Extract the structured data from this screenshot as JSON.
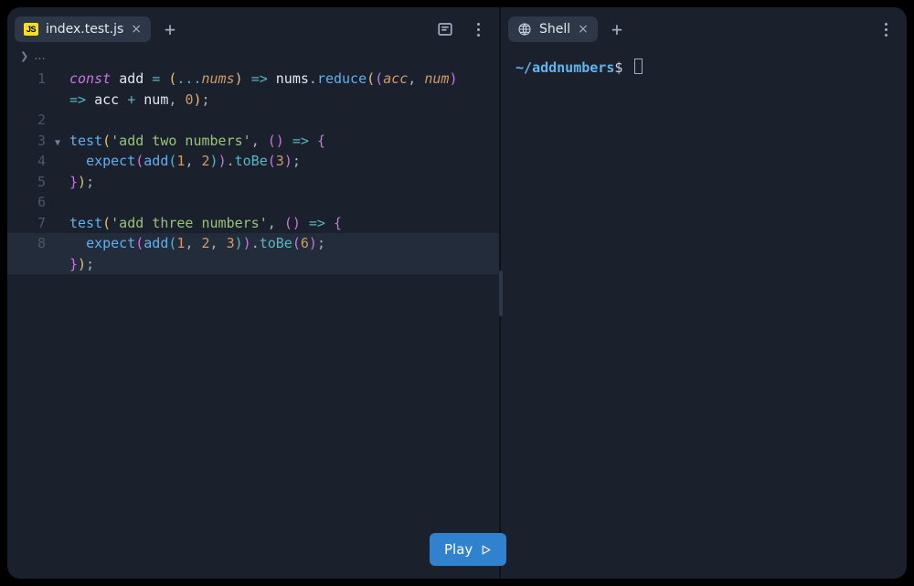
{
  "editor_pane": {
    "tab": {
      "icon_label": "JS",
      "filename": "index.test.js"
    },
    "breadcrumb": "...",
    "code": {
      "lines": [
        {
          "n": "1",
          "html": "<span class='k-decl'>const</span> <span class='k-var'>add</span> <span class='k-op'>=</span> <span class='k-paren'>(</span><span class='k-spread'>...</span><span class='k-param'>nums</span><span class='k-paren'>)</span> <span class='k-op'>=&gt;</span> <span class='k-var'>nums</span><span class='k-dot'>.</span><span class='k-fn'>reduce</span><span class='k-paren'>(</span><span class='k-paren2'>(</span><span class='k-param'>acc</span><span class='k-punc'>,</span> <span class='k-param'>num</span><span class='k-paren2'>)</span>"
        },
        {
          "n": "",
          "wrap": true,
          "html": "<span class='k-op'>=&gt;</span> <span class='k-var'>acc</span> <span class='k-op'>+</span> <span class='k-var'>num</span><span class='k-punc'>,</span> <span class='k-num'>0</span><span class='k-paren'>)</span><span class='k-punc'>;</span>"
        },
        {
          "n": "2",
          "html": ""
        },
        {
          "n": "3",
          "fold": true,
          "html": "<span class='k-fn'>test</span><span class='k-paren'>(</span><span class='k-str'>'add two numbers'</span><span class='k-punc'>,</span> <span class='k-paren2'>(</span><span class='k-paren2'>)</span> <span class='k-op'>=&gt;</span> <span class='k-paren2'>{</span>"
        },
        {
          "n": "4",
          "html": "  <span class='k-fn'>expect</span><span class='k-paren2'>(</span><span class='k-fn'>add</span><span class='k-paren3'>(</span><span class='k-num'>1</span><span class='k-punc'>,</span> <span class='k-num'>2</span><span class='k-paren3'>)</span><span class='k-paren2'>)</span><span class='k-dot'>.</span><span class='k-method'>toBe</span><span class='k-paren2'>(</span><span class='k-num'>3</span><span class='k-paren2'>)</span><span class='k-punc'>;</span>"
        },
        {
          "n": "5",
          "html": "<span class='k-paren2'>}</span><span class='k-paren'>)</span><span class='k-punc'>;</span>"
        },
        {
          "n": "6",
          "html": ""
        },
        {
          "n": "7",
          "html": "<span class='k-fn'>test</span><span class='k-paren'>(</span><span class='k-str'>'add three numbers'</span><span class='k-punc'>,</span> <span class='k-paren2'>(</span><span class='k-paren2'>)</span> <span class='k-op'>=&gt;</span> <span class='k-paren2'>{</span>"
        },
        {
          "n": "8",
          "hl": true,
          "html": "  <span class='k-fn'>expect</span><span class='k-paren2'>(</span><span class='k-fn'>add</span><span class='k-paren3'>(</span><span class='k-num'>1</span><span class='k-punc'>,</span> <span class='k-num'>2</span><span class='k-punc'>,</span> <span class='k-num'>3</span><span class='k-paren3'>)</span><span class='k-paren2'>)</span><span class='k-dot'>.</span><span class='k-method'>toBe</span><span class='k-paren2'>(</span><span class='k-num'>6</span><span class='k-paren2'>)</span><span class='k-punc'>;</span>"
        },
        {
          "n": "",
          "wrap": true,
          "hl": true,
          "html": "<span class='k-paren2'>}</span><span class='k-paren'>)</span><span class='k-punc'>;</span>"
        }
      ]
    }
  },
  "shell_pane": {
    "tab": {
      "label": "Shell"
    },
    "prompt": {
      "tilde": "~/",
      "path": "addnumbers",
      "suffix": "$"
    }
  },
  "play_button": {
    "label": "Play"
  }
}
